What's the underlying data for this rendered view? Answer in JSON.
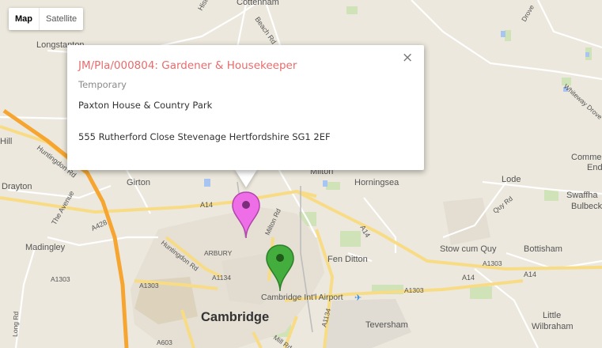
{
  "map_type": {
    "map_label": "Map",
    "satellite_label": "Satellite",
    "selected": "Map"
  },
  "info_window": {
    "title": "JM/Pla/000804: Gardener & Housekeeper",
    "subtitle": "Temporary",
    "venue": "Paxton House & Country Park",
    "address": "555 Rutherford Close Stevenage Hertfordshire SG1 2EF",
    "close_glyph": "×"
  },
  "markers": [
    {
      "name": "pink-marker",
      "color": "#ee6ee8"
    },
    {
      "name": "green-marker",
      "color": "#43ad3d"
    }
  ],
  "labels": {
    "cottenham": "Cottenham",
    "histon_rd_top": "Histon Rd",
    "beach_rd": "Beach Rd",
    "longstanton": "Longstanton",
    "hill": "Hill",
    "drayton": "Drayton",
    "girton": "Girton",
    "huntingdon_rd": "Huntingdon Rd",
    "the_avenue": "The Avenue",
    "a14_west": "A14",
    "a428": "A428",
    "madingley": "Madingley",
    "huntingdon_rd_2": "Huntingdon Rd",
    "arbury": "ARBURY",
    "milton": "Milton",
    "milton_rd": "Milton Rd",
    "horningsea": "Horningsea",
    "a14_east": "A14",
    "fen_ditton": "Fen Ditton",
    "a1134": "A1134",
    "a1303_left": "A1303",
    "a1303_mid": "A1303",
    "a1303_right": "A1303",
    "a1303_east": "A1303",
    "a14_far": "A14",
    "cambridge_airport": "Cambridge Int'l Airport",
    "cambridge": "Cambridge",
    "a1134_south": "A1134",
    "teversham": "Teversham",
    "mill_rd": "Mill Rd",
    "a603": "A603",
    "long_rd": "Long Rd",
    "lode": "Lode",
    "quy_rd": "Quy Rd",
    "swaffham": "Swaffha",
    "bulbeck": "Bulbeck",
    "stow_cum_quy": "Stow cum Quy",
    "bottisham": "Bottisham",
    "little": "Little",
    "wilbraham": "Wilbraham",
    "commercial": "Comme",
    "end": "End",
    "whiteway_drove": "Whiteway Drove",
    "drove_top": "Drove"
  }
}
